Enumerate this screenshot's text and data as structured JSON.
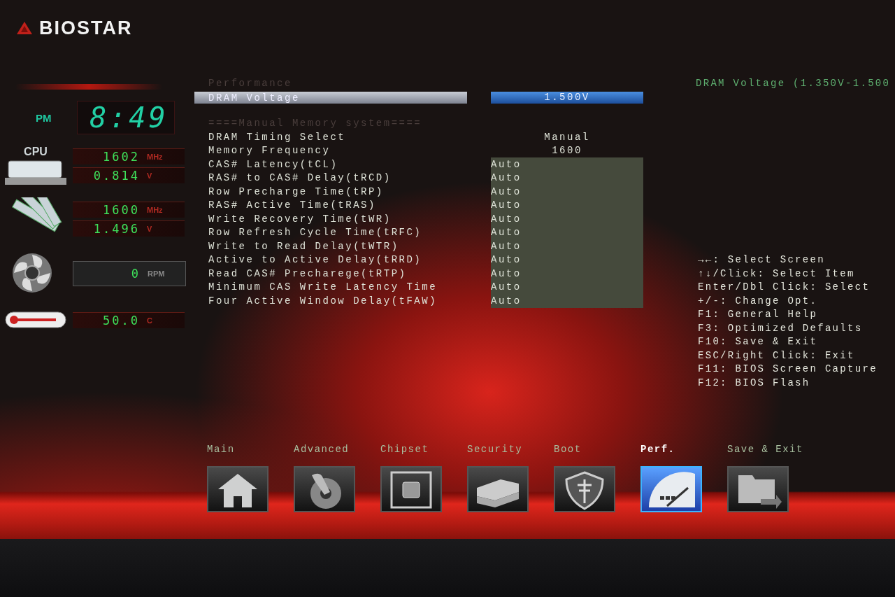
{
  "logo": "BIOSTAR",
  "clock": {
    "period": "PM",
    "time": "8:49"
  },
  "monitors": [
    {
      "kind": "cpu",
      "label": "CPU",
      "readings": [
        {
          "value": "1602",
          "unit": "MHz"
        },
        {
          "value": "0.814",
          "unit": "V"
        }
      ]
    },
    {
      "kind": "memory",
      "readings": [
        {
          "value": "1600",
          "unit": "MHz"
        },
        {
          "value": "1.496",
          "unit": "V"
        }
      ]
    },
    {
      "kind": "fan",
      "readings": [
        {
          "value": "0",
          "unit": "RPM"
        }
      ]
    },
    {
      "kind": "temperature",
      "readings": [
        {
          "value": "50.0",
          "unit": "C"
        }
      ]
    }
  ],
  "settings": [
    {
      "kind": "header",
      "label": "Performance"
    },
    {
      "kind": "option",
      "label": "DRAM Voltage",
      "value": "1.500V",
      "selected": true
    },
    {
      "kind": "header",
      "label": "====Manual Memory system===="
    },
    {
      "kind": "info",
      "label": "DRAM Timing Select",
      "value": "Manual"
    },
    {
      "kind": "info",
      "label": "Memory Frequency",
      "value": "1600"
    },
    {
      "kind": "field",
      "label": "CAS# Latency(tCL)",
      "value": "Auto"
    },
    {
      "kind": "field",
      "label": "RAS# to CAS# Delay(tRCD)",
      "value": "Auto"
    },
    {
      "kind": "field",
      "label": "Row Precharge Time(tRP)",
      "value": "Auto"
    },
    {
      "kind": "field",
      "label": "RAS# Active Time(tRAS)",
      "value": "Auto"
    },
    {
      "kind": "field",
      "label": "Write Recovery Time(tWR)",
      "value": "Auto"
    },
    {
      "kind": "field",
      "label": "Row Refresh Cycle Time(tRFC)",
      "value": "Auto"
    },
    {
      "kind": "field",
      "label": "Write to Read Delay(tWTR)",
      "value": "Auto"
    },
    {
      "kind": "field",
      "label": "Active to Active Delay(tRRD)",
      "value": "Auto"
    },
    {
      "kind": "field",
      "label": "Read CAS# Precharege(tRTP)",
      "value": "Auto"
    },
    {
      "kind": "field",
      "label": "Minimum CAS Write Latency Time",
      "value": "Auto"
    },
    {
      "kind": "field",
      "label": "Four Active Window Delay(tFAW)",
      "value": "Auto"
    }
  ],
  "help": {
    "description": "DRAM Voltage (1.350V-1.500",
    "keys": [
      "→←: Select Screen",
      "↑↓/Click: Select Item",
      "Enter/Dbl Click: Select",
      "+/-: Change Opt.",
      "F1: General Help",
      "F3: Optimized Defaults",
      "F10: Save & Exit",
      "ESC/Right Click: Exit",
      "F11: BIOS Screen Capture",
      "F12: BIOS Flash"
    ]
  },
  "tabs": [
    {
      "label": "Main",
      "selected": false
    },
    {
      "label": "Advanced",
      "selected": false
    },
    {
      "label": "Chipset",
      "selected": false
    },
    {
      "label": "Security",
      "selected": false
    },
    {
      "label": "Boot",
      "selected": false
    },
    {
      "label": "Perf.",
      "selected": true
    },
    {
      "label": "Save & Exit",
      "selected": false
    }
  ]
}
